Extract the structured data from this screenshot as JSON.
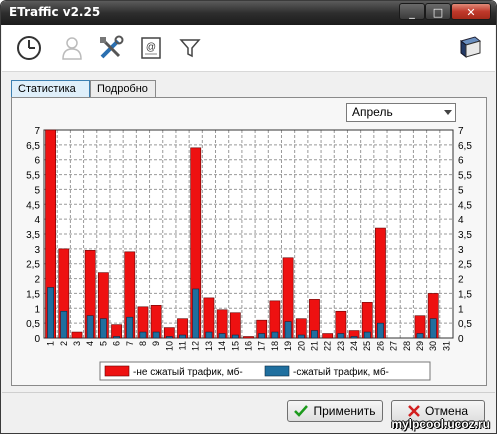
{
  "window": {
    "title": "ETraffic  v2.25"
  },
  "titlebar_buttons": [
    "_",
    "□",
    "✕"
  ],
  "toolbar": {
    "icons": [
      "clock-icon",
      "user-icon",
      "tools-icon",
      "email-icon",
      "filter-icon",
      "book-icon"
    ]
  },
  "tabs": [
    {
      "label": "Статистика",
      "active": true
    },
    {
      "label": "Подробно",
      "active": false
    }
  ],
  "month_select": {
    "value": "Апрель"
  },
  "legend": {
    "uncompressed": "-не сжатый трафик, мб-",
    "compressed": "-сжатый трафик, мб-"
  },
  "buttons": {
    "apply": "Применить",
    "cancel": "Отмена"
  },
  "watermark": "mylpcool.ucoz.ru",
  "colors": {
    "uncompressed": "#ee1111",
    "compressed": "#1f6f9f",
    "accent": "#3c7fb1"
  },
  "chart_data": {
    "type": "bar",
    "categories": [
      "1",
      "2",
      "3",
      "4",
      "5",
      "6",
      "7",
      "8",
      "9",
      "10",
      "11",
      "12",
      "13",
      "14",
      "15",
      "16",
      "17",
      "18",
      "19",
      "20",
      "21",
      "22",
      "23",
      "24",
      "25",
      "26",
      "27",
      "28",
      "29",
      "30",
      "31"
    ],
    "y_ticks": [
      "0",
      "0,5",
      "1",
      "1,5",
      "2",
      "2,5",
      "3",
      "3,5",
      "4",
      "4,5",
      "5",
      "5,5",
      "6",
      "6,5",
      "7"
    ],
    "ylim": [
      0,
      7
    ],
    "grid": true,
    "series": [
      {
        "name": "-не сжатый трафик, мб-",
        "values": [
          7.0,
          3.0,
          0.2,
          2.95,
          2.2,
          0.45,
          2.9,
          1.05,
          1.1,
          0.35,
          0.65,
          6.4,
          1.35,
          0.95,
          0.85,
          0.05,
          0.6,
          1.25,
          2.7,
          0.65,
          1.3,
          0.15,
          0.9,
          0.25,
          1.2,
          3.7,
          0,
          0,
          0.75,
          1.5,
          0
        ]
      },
      {
        "name": "-сжатый трафик, мб-",
        "values": [
          1.7,
          0.9,
          0,
          0.75,
          0.65,
          0.05,
          0.7,
          0.2,
          0.2,
          0.05,
          0.1,
          1.65,
          0.2,
          0.15,
          0.1,
          0,
          0.15,
          0.2,
          0.55,
          0.1,
          0.25,
          0,
          0.15,
          0.05,
          0.2,
          0.5,
          0,
          0,
          0.15,
          0.65,
          0
        ]
      }
    ]
  }
}
